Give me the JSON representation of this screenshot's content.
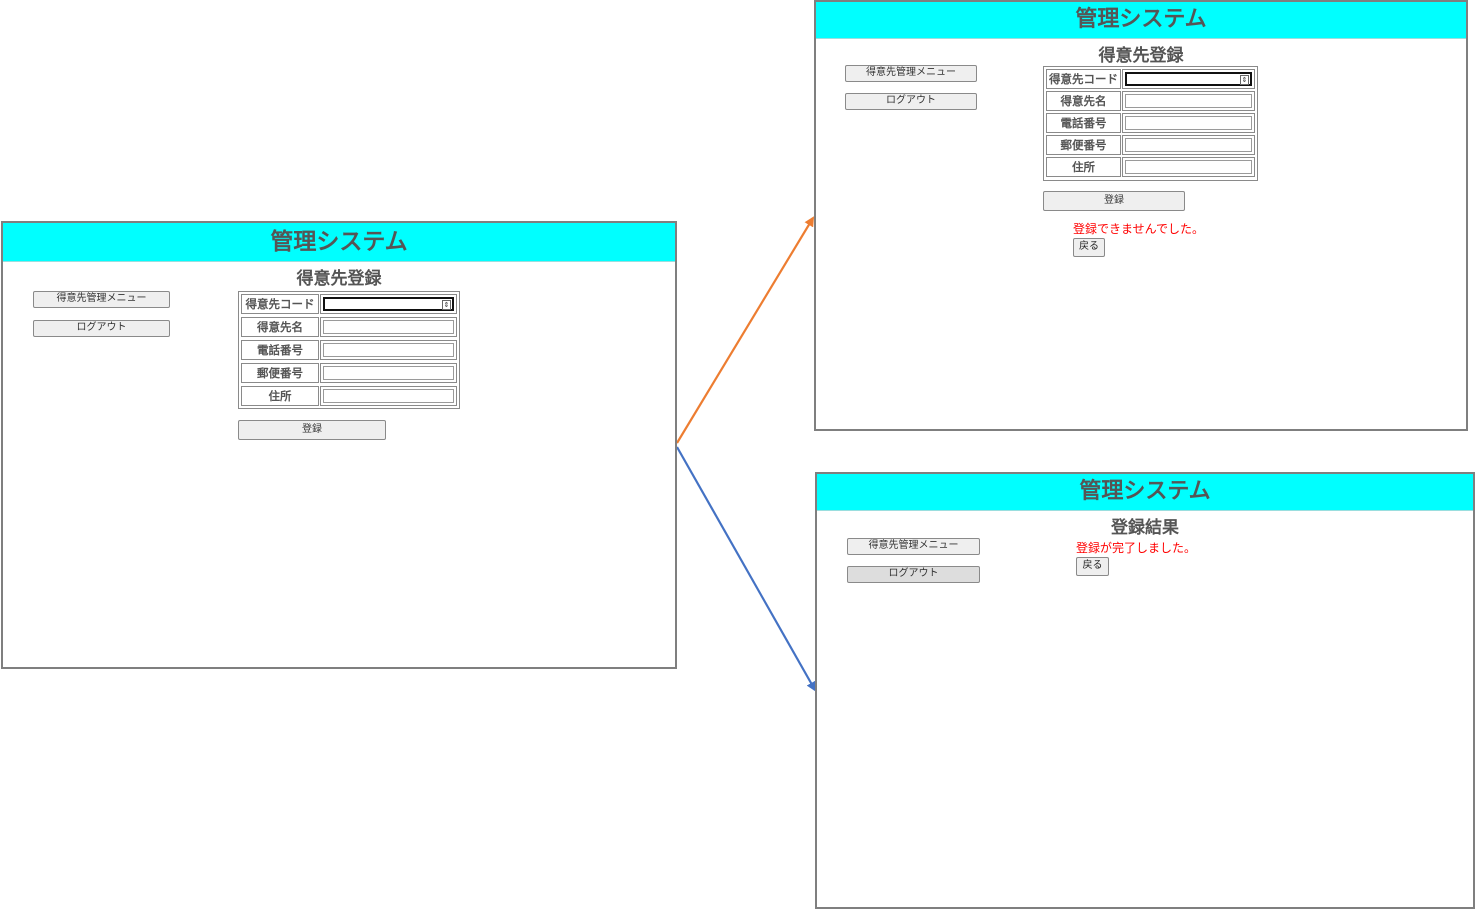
{
  "colors": {
    "header_bg": "#00ffff",
    "error_text": "#ff0000",
    "arrow_failure": "#ed7d31",
    "arrow_success": "#4472c4"
  },
  "input_screen": {
    "app_title": "管理システム",
    "page_title": "得意先登録",
    "menu_button": "得意先管理メニュー",
    "logout_button": "ログアウト",
    "fields": [
      {
        "label": "得意先コード"
      },
      {
        "label": "得意先名"
      },
      {
        "label": "電話番号"
      },
      {
        "label": "郵便番号"
      },
      {
        "label": "住所"
      }
    ],
    "register_button": "登録",
    "spinner_glyph": "⇕"
  },
  "error_screen": {
    "app_title": "管理システム",
    "page_title": "得意先登録",
    "menu_button": "得意先管理メニュー",
    "logout_button": "ログアウト",
    "fields": [
      {
        "label": "得意先コード"
      },
      {
        "label": "得意先名"
      },
      {
        "label": "電話番号"
      },
      {
        "label": "郵便番号"
      },
      {
        "label": "住所"
      }
    ],
    "register_button": "登録",
    "error_message": "登録できませんでした。",
    "back_button": "戻る",
    "spinner_glyph": "⇕"
  },
  "result_screen": {
    "app_title": "管理システム",
    "page_title": "登録結果",
    "menu_button": "得意先管理メニュー",
    "logout_button": "ログアウト",
    "success_message": "登録が完了しました。",
    "back_button": "戻る"
  }
}
